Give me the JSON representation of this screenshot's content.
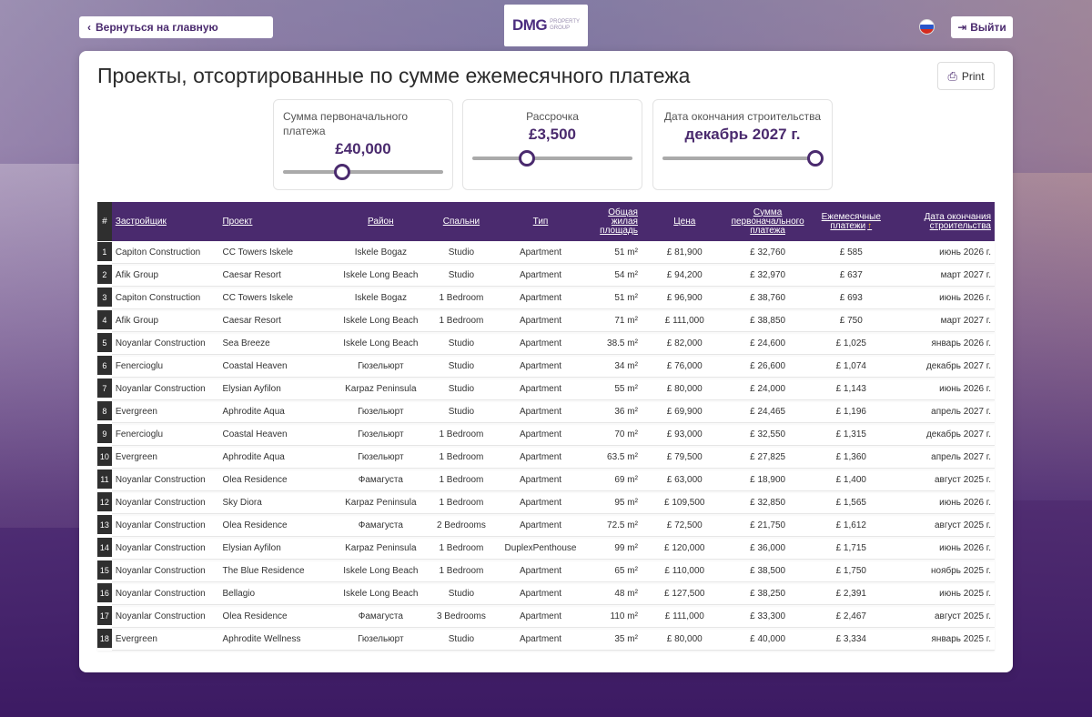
{
  "header": {
    "back_label": "Вернуться на главную",
    "logo_main": "DMG",
    "logo_sub1": "PROPERTY",
    "logo_sub2": "GROUP",
    "logout_label": "Выйти"
  },
  "main": {
    "title": "Проекты, отсортированные по сумме ежемесячного платежа",
    "print_label": "Print"
  },
  "filters": {
    "down_payment": {
      "label": "Сумма первоначального платежа",
      "value": "£40,000",
      "position": 0.37
    },
    "installment": {
      "label": "Рассрочка",
      "value": "£3,500",
      "position": 0.34
    },
    "completion": {
      "label": "Дата окончания строительства",
      "value": "декабрь 2027 г.",
      "position": 1.0
    }
  },
  "table": {
    "headers": {
      "num": "#",
      "developer": "Застройщик",
      "project": "Проект",
      "district": "Район",
      "bedrooms": "Спальни",
      "type": "Тип",
      "area": "Общая жилая площадь",
      "price": "Цена",
      "down": "Сумма первоначального платежа",
      "monthly": "Ежемесячные платежи",
      "completion": "Дата окончания строительства"
    },
    "sort_icon": "arrow-up-icon",
    "rows": [
      [
        "1",
        "Capiton Construction",
        "CC Towers Iskele",
        "Iskele Bogaz",
        "Studio",
        "Apartment",
        "51 m²",
        "£ 81,900",
        "£ 32,760",
        "£ 585",
        "июнь 2026 г."
      ],
      [
        "2",
        "Afik Group",
        "Caesar Resort",
        "Iskele Long Beach",
        "Studio",
        "Apartment",
        "54 m²",
        "£ 94,200",
        "£ 32,970",
        "£ 637",
        "март 2027 г."
      ],
      [
        "3",
        "Capiton Construction",
        "CC Towers Iskele",
        "Iskele Bogaz",
        "1 Bedroom",
        "Apartment",
        "51 m²",
        "£ 96,900",
        "£ 38,760",
        "£ 693",
        "июнь 2026 г."
      ],
      [
        "4",
        "Afik Group",
        "Caesar Resort",
        "Iskele Long Beach",
        "1 Bedroom",
        "Apartment",
        "71 m²",
        "£ 111,000",
        "£ 38,850",
        "£ 750",
        "март 2027 г."
      ],
      [
        "5",
        "Noyanlar Construction",
        "Sea Breeze",
        "Iskele Long Beach",
        "Studio",
        "Apartment",
        "38.5 m²",
        "£ 82,000",
        "£ 24,600",
        "£ 1,025",
        "январь 2026 г."
      ],
      [
        "6",
        "Fenercioglu",
        "Coastal Heaven",
        "Гюзельюрт",
        "Studio",
        "Apartment",
        "34 m²",
        "£ 76,000",
        "£ 26,600",
        "£ 1,074",
        "декабрь 2027 г."
      ],
      [
        "7",
        "Noyanlar Construction",
        "Elysian Ayfilon",
        "Karpaz Peninsula",
        "Studio",
        "Apartment",
        "55 m²",
        "£ 80,000",
        "£ 24,000",
        "£ 1,143",
        "июнь 2026 г."
      ],
      [
        "8",
        "Evergreen",
        "Aphrodite Aqua",
        "Гюзельюрт",
        "Studio",
        "Apartment",
        "36 m²",
        "£ 69,900",
        "£ 24,465",
        "£ 1,196",
        "апрель 2027 г."
      ],
      [
        "9",
        "Fenercioglu",
        "Coastal Heaven",
        "Гюзельюрт",
        "1 Bedroom",
        "Apartment",
        "70 m²",
        "£ 93,000",
        "£ 32,550",
        "£ 1,315",
        "декабрь 2027 г."
      ],
      [
        "10",
        "Evergreen",
        "Aphrodite Aqua",
        "Гюзельюрт",
        "1 Bedroom",
        "Apartment",
        "63.5 m²",
        "£ 79,500",
        "£ 27,825",
        "£ 1,360",
        "апрель 2027 г."
      ],
      [
        "11",
        "Noyanlar Construction",
        "Olea Residence",
        "Фамагуста",
        "1 Bedroom",
        "Apartment",
        "69 m²",
        "£ 63,000",
        "£ 18,900",
        "£ 1,400",
        "август 2025 г."
      ],
      [
        "12",
        "Noyanlar Construction",
        "Sky Diora",
        "Karpaz Peninsula",
        "1 Bedroom",
        "Apartment",
        "95 m²",
        "£ 109,500",
        "£ 32,850",
        "£ 1,565",
        "июнь 2026 г."
      ],
      [
        "13",
        "Noyanlar Construction",
        "Olea Residence",
        "Фамагуста",
        "2 Bedrooms",
        "Apartment",
        "72.5 m²",
        "£ 72,500",
        "£ 21,750",
        "£ 1,612",
        "август 2025 г."
      ],
      [
        "14",
        "Noyanlar Construction",
        "Elysian Ayfilon",
        "Karpaz Peninsula",
        "1 Bedroom",
        "DuplexPenthouse",
        "99 m²",
        "£ 120,000",
        "£ 36,000",
        "£ 1,715",
        "июнь 2026 г."
      ],
      [
        "15",
        "Noyanlar Construction",
        "The Blue Residence",
        "Iskele Long Beach",
        "1 Bedroom",
        "Apartment",
        "65 m²",
        "£ 110,000",
        "£ 38,500",
        "£ 1,750",
        "ноябрь 2025 г."
      ],
      [
        "16",
        "Noyanlar Construction",
        "Bellagio",
        "Iskele Long Beach",
        "Studio",
        "Apartment",
        "48 m²",
        "£ 127,500",
        "£ 38,250",
        "£ 2,391",
        "июнь 2025 г."
      ],
      [
        "17",
        "Noyanlar Construction",
        "Olea Residence",
        "Фамагуста",
        "3 Bedrooms",
        "Apartment",
        "110 m²",
        "£ 111,000",
        "£ 33,300",
        "£ 2,467",
        "август 2025 г."
      ],
      [
        "18",
        "Evergreen",
        "Aphrodite Wellness",
        "Гюзельюрт",
        "Studio",
        "Apartment",
        "35 m²",
        "£ 80,000",
        "£ 40,000",
        "£ 3,334",
        "январь 2025 г."
      ]
    ]
  }
}
